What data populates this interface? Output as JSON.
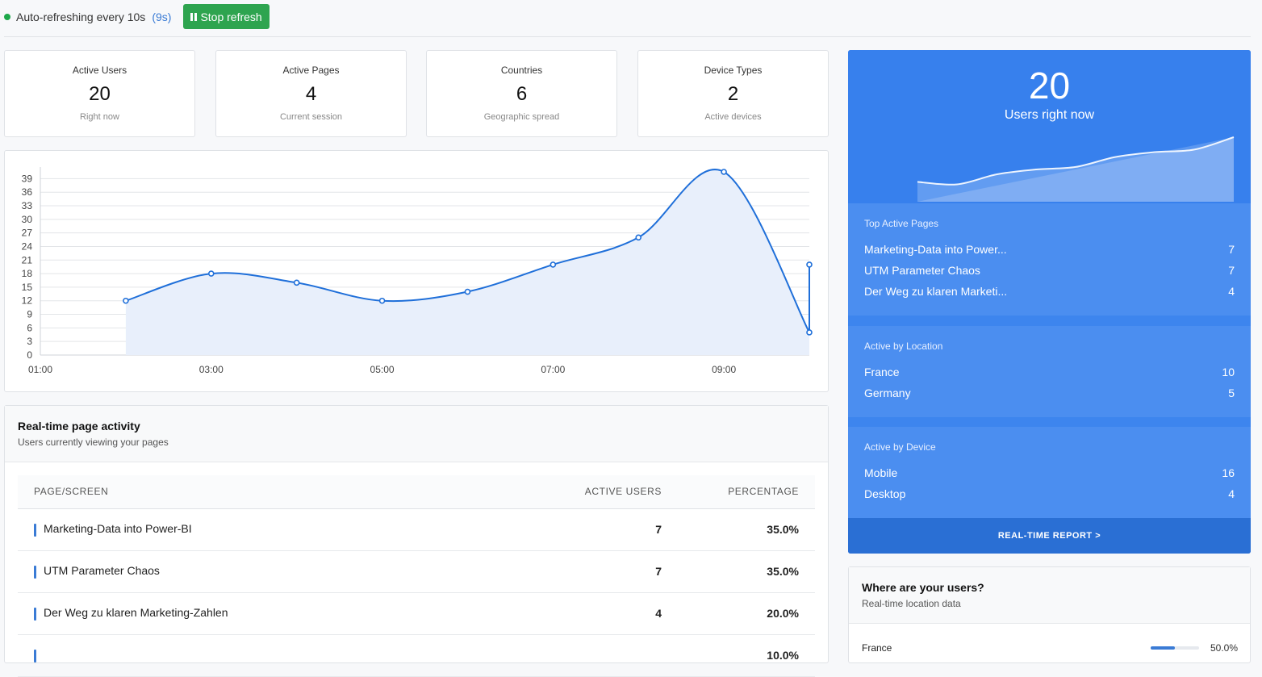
{
  "topbar": {
    "status": "Auto-refreshing every 10s",
    "countdown": "(9s)",
    "stop_label": "Stop refresh",
    "status_color": "#1ea84a"
  },
  "stats": [
    {
      "label": "Active Users",
      "value": "20",
      "sub": "Right now"
    },
    {
      "label": "Active Pages",
      "value": "4",
      "sub": "Current session"
    },
    {
      "label": "Countries",
      "value": "6",
      "sub": "Geographic spread"
    },
    {
      "label": "Device Types",
      "value": "2",
      "sub": "Active devices"
    }
  ],
  "chart_data": {
    "type": "area",
    "title": "",
    "xlabel": "",
    "ylabel": "",
    "x_ticks": [
      "01:00",
      "03:00",
      "05:00",
      "07:00",
      "09:00"
    ],
    "y_ticks": [
      0,
      3,
      6,
      9,
      12,
      15,
      18,
      21,
      24,
      27,
      30,
      33,
      36,
      39
    ],
    "ylim": [
      0,
      40.5
    ],
    "xlim": [
      1,
      10
    ],
    "x": [
      2,
      3,
      4,
      5,
      6,
      7,
      8,
      9,
      10,
      10
    ],
    "values": [
      12,
      18,
      16,
      12,
      14,
      20,
      26,
      40.5,
      5,
      20
    ],
    "color": "#1f6fd9",
    "fill": "#e8effb",
    "grid": true
  },
  "activity": {
    "title": "Real-time page activity",
    "subtitle": "Users currently viewing your pages",
    "columns": [
      "PAGE/SCREEN",
      "ACTIVE USERS",
      "PERCENTAGE"
    ],
    "rows": [
      {
        "page": "Marketing-Data into Power-BI",
        "users": "7",
        "pct": "35.0%"
      },
      {
        "page": "UTM Parameter Chaos",
        "users": "7",
        "pct": "35.0%"
      },
      {
        "page": "Der Weg zu klaren Marketing-Zahlen",
        "users": "4",
        "pct": "20.0%"
      },
      {
        "page": "",
        "users": "",
        "pct": "10.0%"
      }
    ]
  },
  "realtime": {
    "count": "20",
    "count_label": "Users right now",
    "sparkline": [
      4,
      3.5,
      5.5,
      6.5,
      7,
      9,
      10,
      10.5,
      13
    ],
    "top_pages_title": "Top Active Pages",
    "top_pages": [
      {
        "name": "Marketing-Data into Power...",
        "value": "7"
      },
      {
        "name": "UTM Parameter Chaos",
        "value": "7"
      },
      {
        "name": "Der Weg zu klaren Marketi...",
        "value": "4"
      }
    ],
    "location_title": "Active by Location",
    "locations": [
      {
        "name": "France",
        "value": "10"
      },
      {
        "name": "Germany",
        "value": "5"
      }
    ],
    "device_title": "Active by Device",
    "devices": [
      {
        "name": "Mobile",
        "value": "16"
      },
      {
        "name": "Desktop",
        "value": "4"
      }
    ],
    "footer": "REAL-TIME REPORT >"
  },
  "where": {
    "title": "Where are your users?",
    "subtitle": "Real-time location data",
    "first": {
      "name": "France",
      "pct": "50.0%",
      "fraction": 0.5
    }
  }
}
